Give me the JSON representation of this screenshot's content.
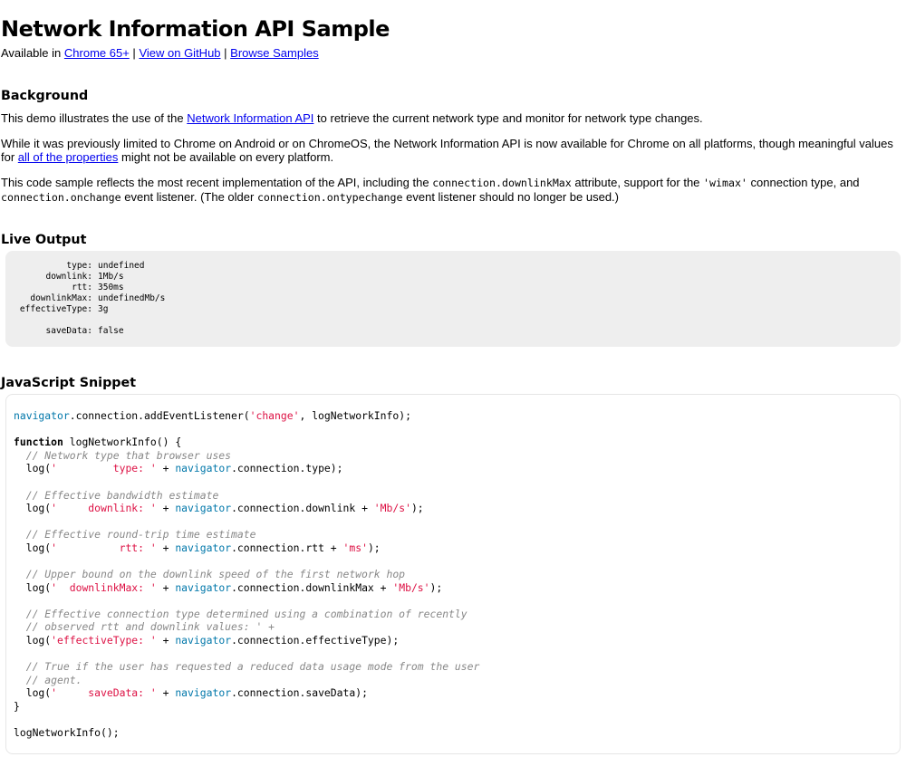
{
  "header": {
    "title": "Network Information API Sample",
    "available_prefix": "Available in",
    "chrome_link": "Chrome 65+",
    "sep1": "|",
    "github_link": "View on GitHub",
    "sep2": "|",
    "samples_link": "Browse Samples"
  },
  "background": {
    "heading": "Background",
    "p1_before": "This demo illustrates the use of the",
    "p1_link": "Network Information API",
    "p1_after": "to retrieve the current network type and monitor for network type changes.",
    "p2_before": "While it was previously limited to Chrome on Android or on ChromeOS, the Network Information API is now available for Chrome on all platforms, though meaningful values for",
    "p2_link": "all of the properties",
    "p2_after": "might not be available on every platform.",
    "p3_a": "This code sample reflects the most recent implementation of the API, including the",
    "p3_code1": "connection.downlinkMax",
    "p3_b": "attribute, support for the",
    "p3_code2": "'wimax'",
    "p3_c": "connection type, and",
    "p3_code3": "connection.onchange",
    "p3_d": "event listener. (The older",
    "p3_code4": "connection.ontypechange",
    "p3_e": "event listener should no longer be used.)"
  },
  "live_output": {
    "heading": "Live Output",
    "rows": [
      {
        "key": "type:",
        "value": "undefined"
      },
      {
        "key": "downlink:",
        "value": "1Mb/s"
      },
      {
        "key": "rtt:",
        "value": "350ms"
      },
      {
        "key": "downlinkMax:",
        "value": "undefinedMb/s"
      },
      {
        "key": "effectiveType:",
        "value": "3g"
      },
      {
        "key": "saveData:",
        "value": "false"
      }
    ]
  },
  "snippet": {
    "heading": "JavaScript Snippet",
    "line_listener": {
      "nav": "navigator",
      "rest": ".connection.addEventListener(",
      "str": "'change'",
      "end": ", logNetworkInfo);"
    },
    "fn_kw": "function",
    "fn_sig": " logNetworkInfo() {",
    "blocks": [
      {
        "comments": [
          "// Network type that browser uses"
        ],
        "log_str": "'         type: '",
        "prop": ".connection.type",
        "suffix": ""
      },
      {
        "comments": [
          "// Effective bandwidth estimate"
        ],
        "log_str": "'     downlink: '",
        "prop": ".connection.downlink",
        "suffix": "'Mb/s'"
      },
      {
        "comments": [
          "// Effective round-trip time estimate"
        ],
        "log_str": "'          rtt: '",
        "prop": ".connection.rtt",
        "suffix": "'ms'"
      },
      {
        "comments": [
          "// Upper bound on the downlink speed of the first network hop"
        ],
        "log_str": "'  downlinkMax: '",
        "prop": ".connection.downlinkMax",
        "suffix": "'Mb/s'"
      },
      {
        "comments": [
          "// Effective connection type determined using a combination of recently",
          "// observed rtt and downlink values: ' +"
        ],
        "log_str": "'effectiveType: '",
        "prop": ".connection.effectiveType",
        "suffix": ""
      },
      {
        "comments": [
          "// True if the user has requested a reduced data usage mode from the user",
          "// agent."
        ],
        "log_str": "'     saveData: '",
        "prop": ".connection.saveData",
        "suffix": ""
      }
    ],
    "log_fn": "log(",
    "plus": " + ",
    "nav": "navigator",
    "close": "}",
    "call": "logNetworkInfo();"
  }
}
